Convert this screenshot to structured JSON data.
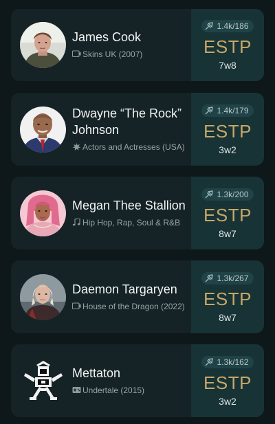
{
  "profiles": [
    {
      "name": "James Cook",
      "category": "Skins UK (2007)",
      "category_icon": "tv-icon",
      "votes": "1.4k/186",
      "type": "ESTP",
      "wing": "7w8",
      "avatar": "avatar-photo-young-man-hoodie"
    },
    {
      "name": "Dwayne “The Rock” Johnson",
      "category": "Actors and Actresses (USA)",
      "category_icon": "star-burst-icon",
      "votes": "1.4k/179",
      "type": "ESTP",
      "wing": "3w2",
      "avatar": "avatar-photo-bald-man"
    },
    {
      "name": "Megan Thee Stallion",
      "category": "Hip Hop, Rap, Soul & R&B",
      "category_icon": "music-note-icon",
      "votes": "1.3k/200",
      "type": "ESTP",
      "wing": "8w7",
      "avatar": "avatar-photo-woman-pink-hair"
    },
    {
      "name": "Daemon Targaryen",
      "category": "House of the Dragon (2022)",
      "category_icon": "tv-icon",
      "votes": "1.3k/267",
      "type": "ESTP",
      "wing": "8w7",
      "avatar": "avatar-photo-platinum-hair"
    },
    {
      "name": "Mettaton",
      "category": "Undertale (2015)",
      "category_icon": "gamepad-icon",
      "votes": "1.3k/162",
      "type": "ESTP",
      "wing": "3w2",
      "avatar": "avatar-sprite-robot"
    }
  ],
  "colors": {
    "background": "#0e1719",
    "card": "#152326",
    "card_right": "#173336",
    "type_gold": "#c7a767",
    "votes_pill": "#1f4347"
  }
}
